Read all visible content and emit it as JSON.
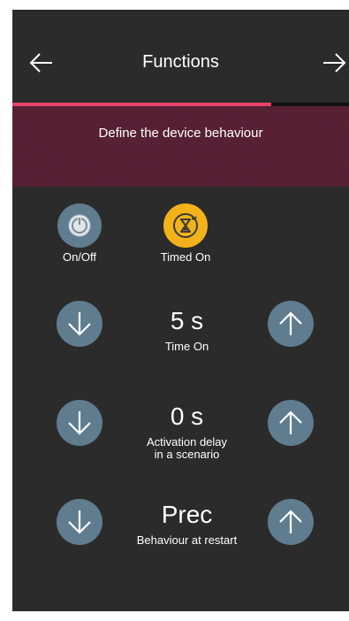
{
  "header": {
    "title": "Functions",
    "back_icon": "arrow-left-icon",
    "forward_icon": "arrow-right-icon"
  },
  "progress": {
    "fraction": 0.77,
    "color": "#e8426b"
  },
  "banner": {
    "subtitle": "Define the device behaviour"
  },
  "modes": [
    {
      "label": "On/Off",
      "icon": "power-icon",
      "color": "#5f7d8f"
    },
    {
      "label": "Timed On",
      "icon": "hourglass-icon",
      "color": "#f2b31a"
    }
  ],
  "settings": [
    {
      "value": "5 s",
      "label": "Time On"
    },
    {
      "value": "0 s",
      "label": "Activation delay\nin a scenario"
    },
    {
      "value": "Prec",
      "label": "Behaviour at restart"
    }
  ]
}
